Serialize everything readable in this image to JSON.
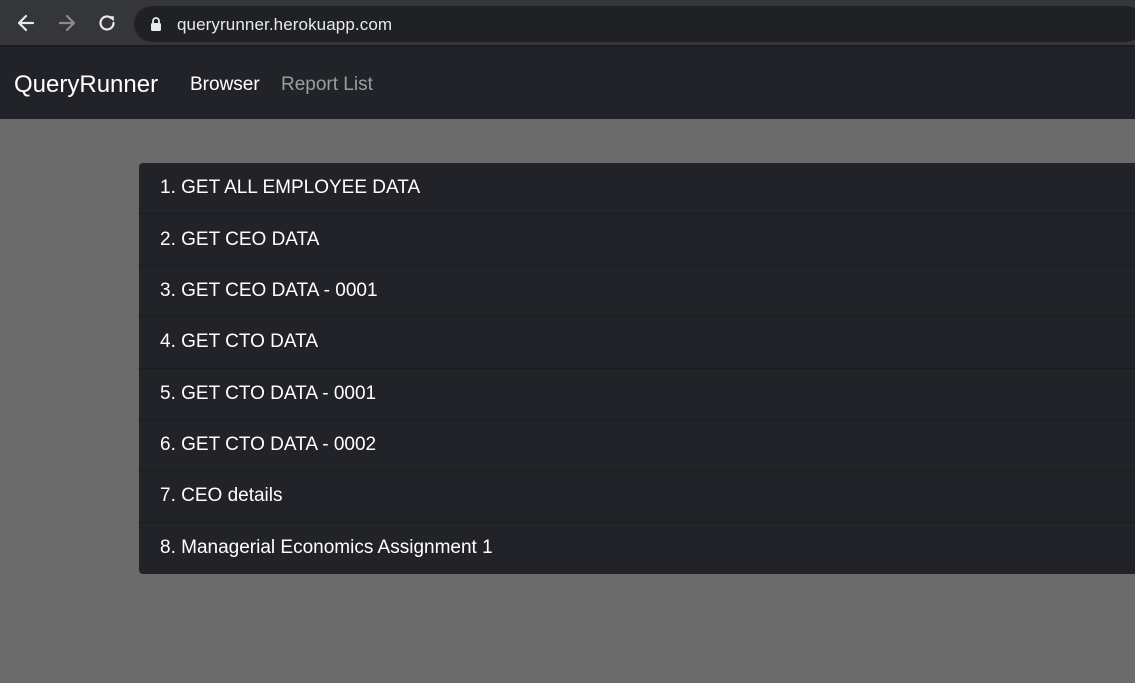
{
  "browser": {
    "url": "queryrunner.herokuapp.com",
    "icons": {
      "back": "arrow-left-icon",
      "forward": "arrow-right-icon",
      "reload": "reload-icon",
      "lock": "lock-icon"
    }
  },
  "navbar": {
    "brand": "QueryRunner",
    "links": [
      {
        "label": "Browser",
        "active": true
      },
      {
        "label": "Report List",
        "active": false
      }
    ]
  },
  "queries": [
    "1. GET ALL EMPLOYEE DATA",
    "2. GET CEO DATA",
    "3. GET CEO DATA - 0001",
    "4. GET CTO DATA",
    "5. GET CTO DATA - 0001",
    "6. GET CTO DATA - 0002",
    "7. CEO details",
    "8. Managerial Economics Assignment 1"
  ],
  "colors": {
    "page_background": "#6b6b6b",
    "navbar_background": "#212328",
    "list_background": "#212328",
    "text": "#ffffff",
    "muted_link": "#9a9da1"
  }
}
